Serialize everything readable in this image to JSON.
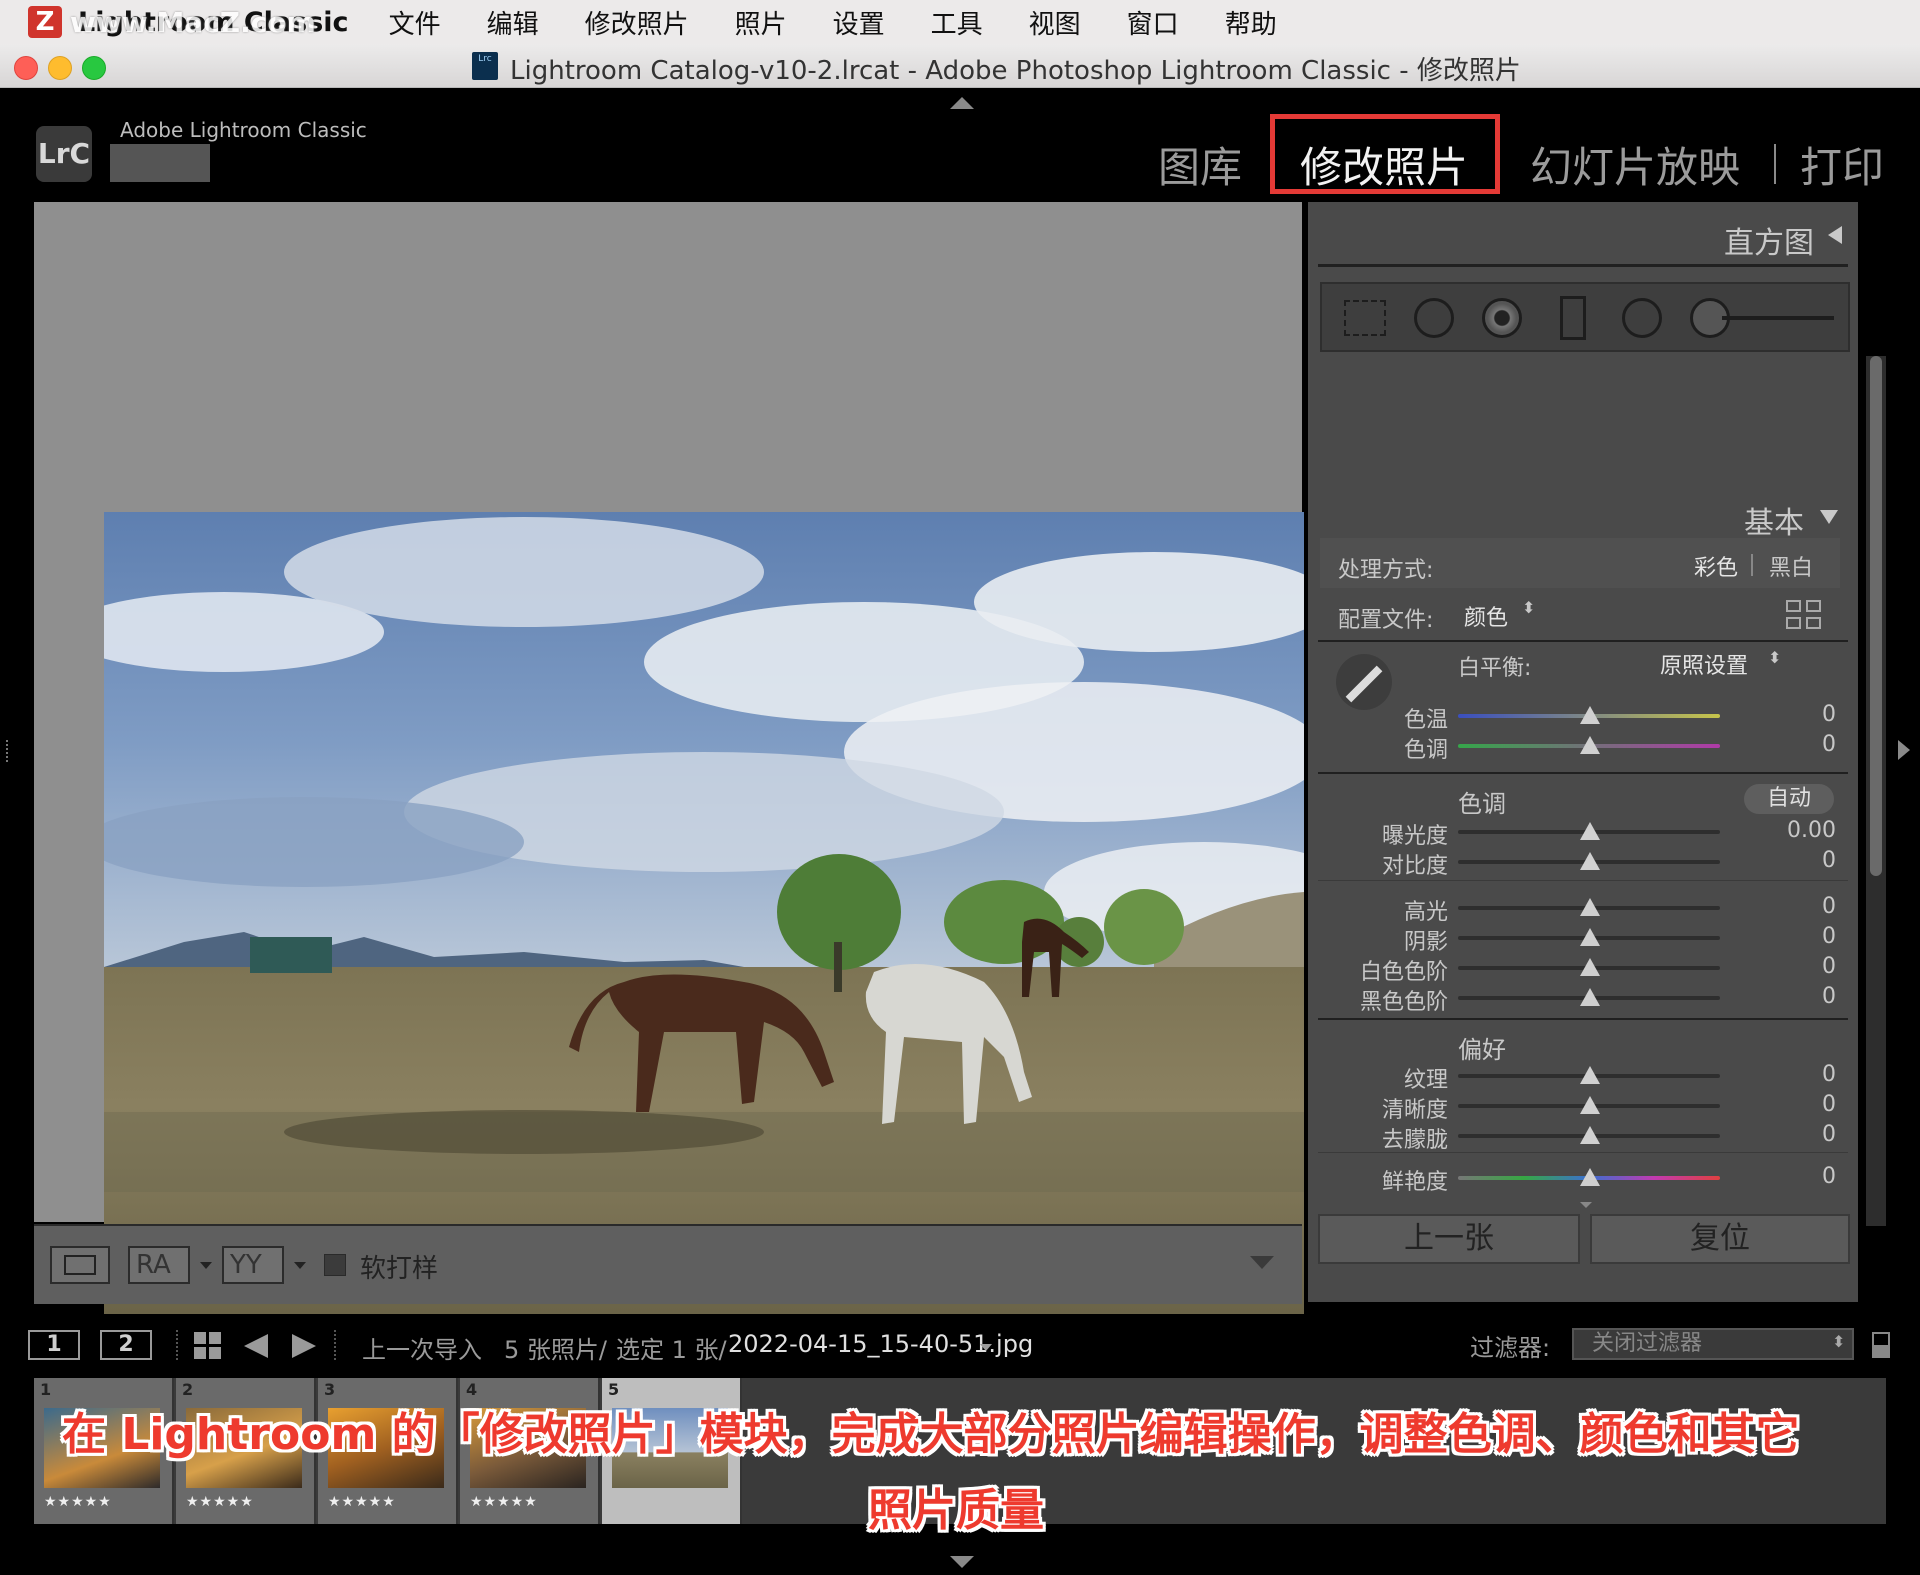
{
  "menubar": {
    "app_name": "Lightroom Classic",
    "watermark": "www.MacZ.com",
    "watermark_logo": "Z",
    "items": [
      "文件",
      "编辑",
      "修改照片",
      "照片",
      "设置",
      "工具",
      "视图",
      "窗口",
      "帮助"
    ]
  },
  "window": {
    "title": "Lightroom Catalog-v10-2.lrcat - Adobe Photoshop Lightroom Classic - 修改照片",
    "doc_icon": "Lrc"
  },
  "identity": {
    "logo_text": "LrC",
    "app_label": "Adobe Lightroom Classic"
  },
  "modules": {
    "library": "图库",
    "develop": "修改照片",
    "slideshow": "幻灯片放映",
    "print": "打印"
  },
  "right_panel": {
    "histogram_title": "直方图",
    "basic_title": "基本",
    "treatment_label": "处理方式:",
    "treatment_color": "彩色",
    "treatment_bw": "黑白",
    "profile_label": "配置文件:",
    "profile_value": "颜色",
    "wb_label": "白平衡:",
    "wb_value": "原照设置",
    "tone_section": "色调",
    "auto_label": "自动",
    "presence_section": "偏好",
    "sliders": {
      "temp": {
        "label": "色温",
        "value": "0"
      },
      "tint": {
        "label": "色调",
        "value": "0"
      },
      "exposure": {
        "label": "曝光度",
        "value": "0.00"
      },
      "contrast": {
        "label": "对比度",
        "value": "0"
      },
      "highlights": {
        "label": "高光",
        "value": "0"
      },
      "shadows": {
        "label": "阴影",
        "value": "0"
      },
      "whites": {
        "label": "白色色阶",
        "value": "0"
      },
      "blacks": {
        "label": "黑色色阶",
        "value": "0"
      },
      "texture": {
        "label": "纹理",
        "value": "0"
      },
      "clarity": {
        "label": "清晰度",
        "value": "0"
      },
      "dehaze": {
        "label": "去朦胧",
        "value": "0"
      },
      "vibrance": {
        "label": "鲜艳度",
        "value": "0"
      }
    },
    "previous_button": "上一张",
    "reset_button": "复位"
  },
  "toolbar": {
    "ra": "RA",
    "yy": "YY",
    "soft_proof": "软打样"
  },
  "filmbar": {
    "view1": "1",
    "view2": "2",
    "source": "上一次导入",
    "count": "5 张照片/",
    "selected": "选定 1 张/",
    "filename": "2022-04-15_15-40-51.jpg",
    "filter_label": "过滤器:",
    "filter_value": "关闭过滤器"
  },
  "filmstrip": [
    {
      "num": "1",
      "stars": "★★★★★"
    },
    {
      "num": "2",
      "stars": "★★★★★"
    },
    {
      "num": "3",
      "stars": "★★★★★"
    },
    {
      "num": "4",
      "stars": "★★★★★"
    },
    {
      "num": "5",
      "stars": ""
    }
  ],
  "caption": {
    "line1": "在 Lightroom 的「修改照片」模块，完成大部分照片编辑操作，调整色调、颜色和其它",
    "line2": "照片质量"
  },
  "colors": {
    "highlight_red": "#e43a36",
    "caption_red": "#ee3a2e"
  }
}
